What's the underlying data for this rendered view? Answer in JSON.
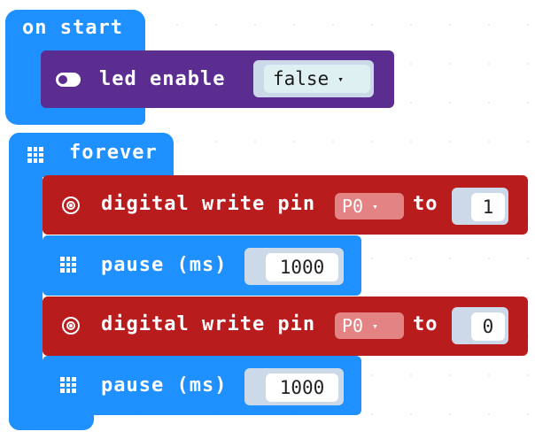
{
  "on_start": {
    "label": "on start",
    "block": {
      "label": "led enable",
      "value": "false",
      "dropdown_arrow": "▾",
      "icon": "toggle-icon"
    }
  },
  "forever": {
    "label": "forever",
    "icon": "grid-icon",
    "blocks": [
      {
        "label": "digital write pin",
        "pin": "P0",
        "to_label": "to",
        "value": "1",
        "dropdown_arrow": "▾",
        "icon": "target-icon"
      },
      {
        "label": "pause (ms)",
        "value": "1000",
        "icon": "grid-icon"
      },
      {
        "label": "digital write pin",
        "pin": "P0",
        "to_label": "to",
        "value": "0",
        "dropdown_arrow": "▾",
        "icon": "target-icon"
      },
      {
        "label": "pause (ms)",
        "value": "1000",
        "icon": "grid-icon"
      }
    ]
  },
  "colors": {
    "event_blue": "#1e90ff",
    "led_purple": "#5c2d91",
    "pins_red": "#b91c1c",
    "basic_blue": "#1e90ff",
    "slot_grey": "#ccd9e8",
    "dropdown_red": "#e48383"
  }
}
